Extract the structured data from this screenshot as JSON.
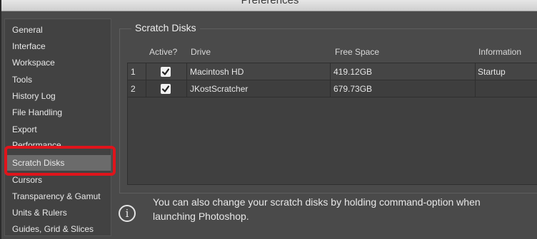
{
  "window": {
    "title": "Preferences"
  },
  "sidebar": {
    "items": [
      {
        "label": "General"
      },
      {
        "label": "Interface"
      },
      {
        "label": "Workspace"
      },
      {
        "label": "Tools"
      },
      {
        "label": "History Log"
      },
      {
        "label": "File Handling"
      },
      {
        "label": "Export"
      },
      {
        "label": "Performance"
      },
      {
        "label": "Scratch Disks",
        "selected": true
      },
      {
        "label": "Cursors"
      },
      {
        "label": "Transparency & Gamut"
      },
      {
        "label": "Units & Rulers"
      },
      {
        "label": "Guides, Grid & Slices"
      }
    ]
  },
  "scratch": {
    "title": "Scratch Disks",
    "columns": {
      "active": "Active?",
      "drive": "Drive",
      "free": "Free Space",
      "info": "Information"
    },
    "rows": [
      {
        "num": "1",
        "active": true,
        "drive": "Macintosh HD",
        "free": "419.12GB",
        "info": "Startup"
      },
      {
        "num": "2",
        "active": true,
        "drive": "JKostScratcher",
        "free": "679.73GB",
        "info": ""
      }
    ]
  },
  "info": {
    "icon": "info-icon",
    "text": "You can also change your scratch disks by holding command-option when launching Photoshop."
  },
  "colors": {
    "highlight": "#e0141b",
    "selected": "#6b6b6b",
    "panel": "#4a4a4a"
  }
}
